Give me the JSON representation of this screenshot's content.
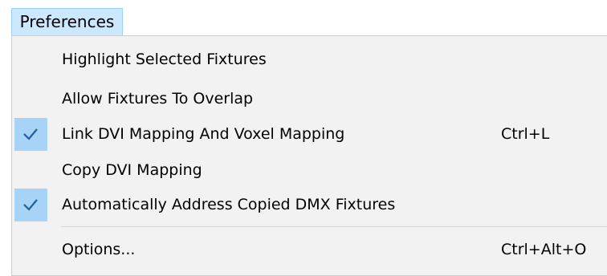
{
  "menubar": {
    "active_menu": "Preferences"
  },
  "menu": {
    "items": [
      {
        "label": "Highlight Selected Fixtures",
        "shortcut": "",
        "checked": false
      },
      {
        "label": "Allow Fixtures To Overlap",
        "shortcut": "",
        "checked": false
      },
      {
        "label": "Link DVI Mapping And Voxel Mapping",
        "shortcut": "Ctrl+L",
        "checked": true
      },
      {
        "label": "Copy DVI Mapping",
        "shortcut": "",
        "checked": false
      },
      {
        "label": "Automatically Address Copied DMX Fixtures",
        "shortcut": "",
        "checked": true
      },
      {
        "label": "Options...",
        "shortcut": "Ctrl+Alt+O",
        "checked": false
      }
    ]
  },
  "colors": {
    "menubar_highlight": "#cce8ff",
    "menubar_highlight_border": "#99d1ff",
    "menu_background": "#f2f2f2",
    "check_background": "#a7d3f7",
    "check_mark": "#1e5f99"
  },
  "icons": {
    "check": "check-icon"
  }
}
